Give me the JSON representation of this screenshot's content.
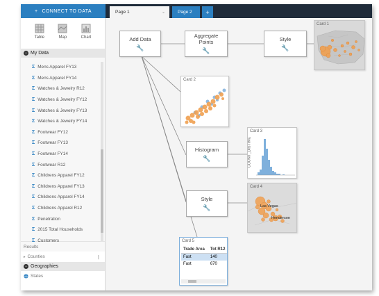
{
  "topbar": {
    "connect_label": "CONNECT TO DATA",
    "connect_icon": "plus-icon",
    "tabs": [
      {
        "label": "Page 1",
        "active": true
      },
      {
        "label": "Page 2",
        "active": false
      }
    ],
    "add_tab": "+"
  },
  "sidebar": {
    "viz": [
      {
        "label": "Table",
        "icon": "table-icon"
      },
      {
        "label": "Map",
        "icon": "map-icon"
      },
      {
        "label": "Chart",
        "icon": "chart-icon"
      }
    ],
    "my_data_label": "My Data",
    "fields": [
      "Mens Apparel FY13",
      "Mens Apparel FY14",
      "Watches & Jewelry R12",
      "Watches & Jewelry FY12",
      "Watches & Jewelry FY13",
      "Watches & Jewelry FY14",
      "Footwear FY12",
      "Footwear FY13",
      "Footwear FY14",
      "Footwear R12",
      "Childrens Apparel FY12",
      "Childrens Apparel FY13",
      "Childrens Apparel FY14",
      "Childrens Apparel R12",
      "Penetration",
      "2015 Total Households",
      "Customers"
    ],
    "results_label": "Results",
    "counties_label": "Counties",
    "geographies_label": "Geographies",
    "states_label": "States"
  },
  "canvas": {
    "nodes": {
      "add_data": "Add Data",
      "aggregate": "Aggregate Points",
      "style1": "Style",
      "histogram": "Histogram",
      "style2": "Style"
    },
    "cards": {
      "card1": "Card 1",
      "card2": "Card 2",
      "card3": "Card 3",
      "card3_axis": "COUNT_DISTINC",
      "card4": "Card 4",
      "card4_city1": "Las Vegas",
      "card4_city2": "Henderson",
      "card5": "Card 5"
    },
    "table": {
      "headers": [
        "Trade Area",
        "Tot R12"
      ],
      "rows": [
        [
          "Fast",
          "140"
        ],
        [
          "Fast",
          "670"
        ]
      ]
    }
  },
  "colors": {
    "accent": "#2b7fc0",
    "topbar": "#1f2b3a",
    "bubble": "#f0a050",
    "scatter_blue": "#7fb0dc"
  }
}
